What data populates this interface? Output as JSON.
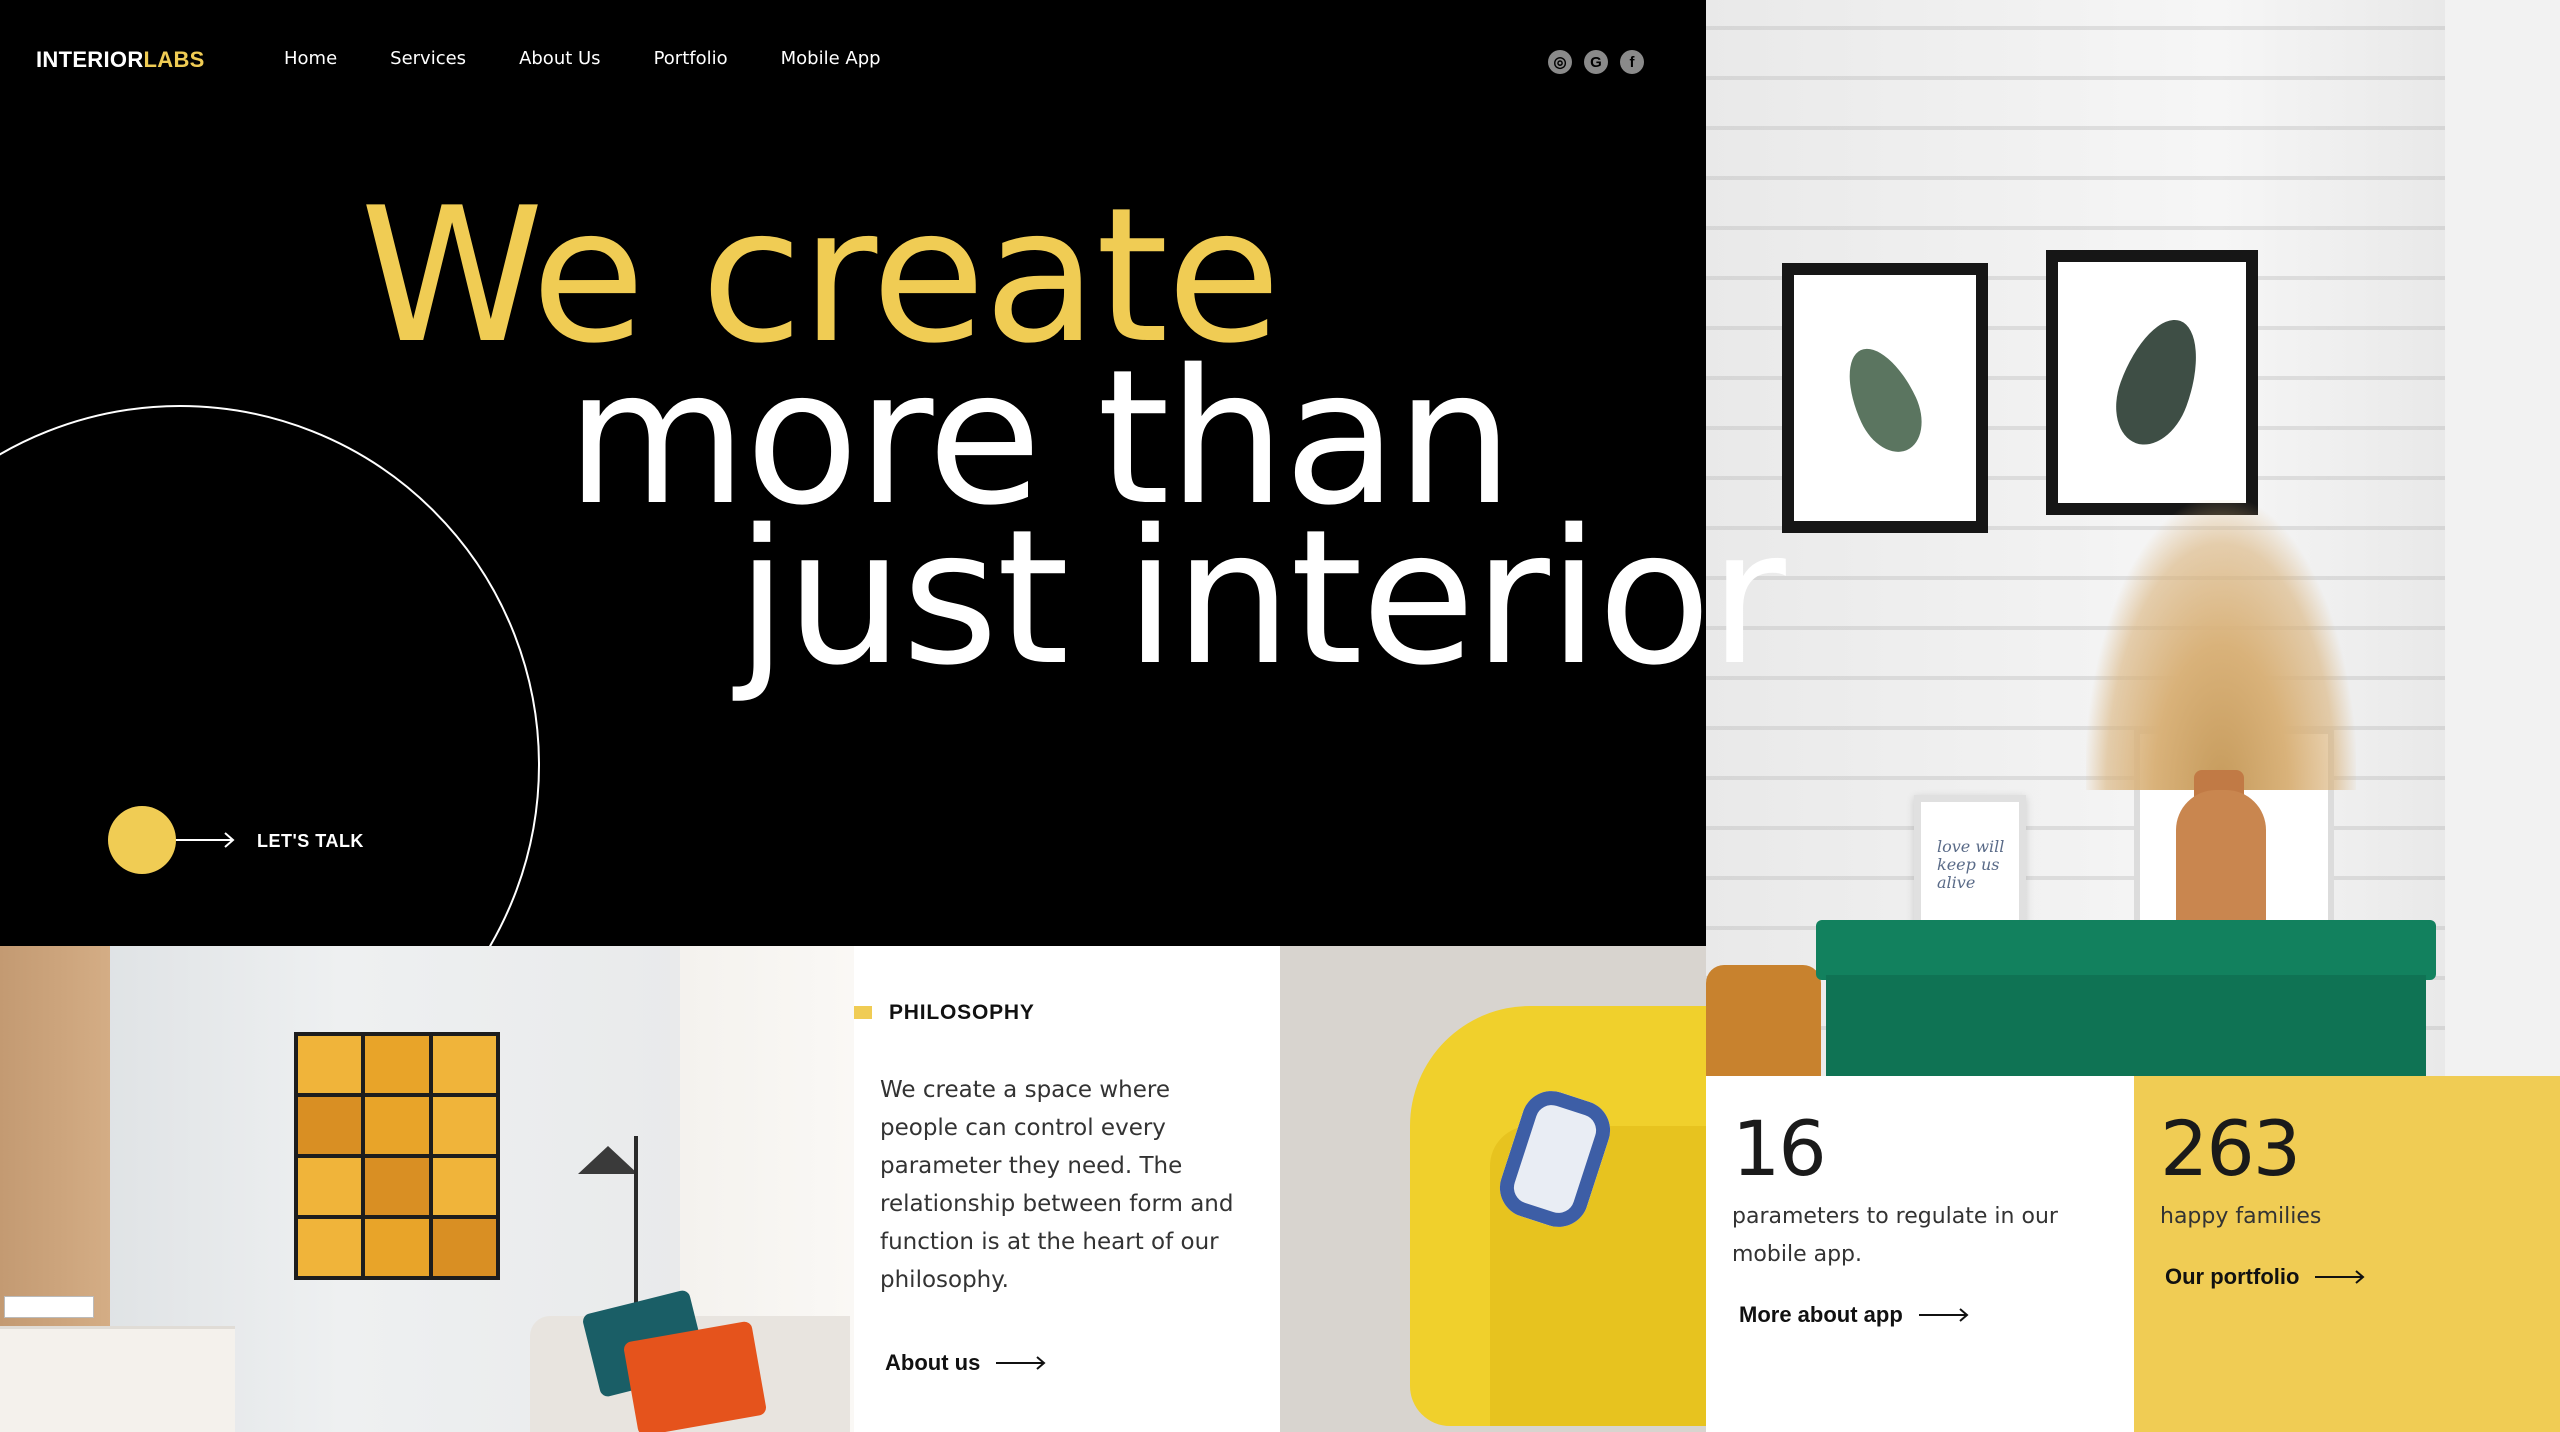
{
  "brand": {
    "part1": "INTERIOR",
    "part2": "LABS",
    "accent_color": "#f0cc54"
  },
  "nav": {
    "items": [
      {
        "label": "Home"
      },
      {
        "label": "Services"
      },
      {
        "label": "About Us"
      },
      {
        "label": "Portfolio"
      },
      {
        "label": "Mobile App"
      }
    ]
  },
  "socials": [
    {
      "icon": "instagram-icon",
      "glyph": "◎"
    },
    {
      "icon": "google-icon",
      "glyph": "G"
    },
    {
      "icon": "facebook-icon",
      "glyph": "f"
    }
  ],
  "hero": {
    "line1": "We create",
    "line2": "more than",
    "line3": "just interior",
    "cta_label": "LET'S TALK"
  },
  "philosophy": {
    "title": "PHILOSOPHY",
    "text": "We create a space where people can control every parameter they need. The relationship between form and function is at the heart of our philosophy.",
    "link_label": "About us"
  },
  "stats": [
    {
      "number": "16",
      "text": "parameters to regulate in our mobile app.",
      "link_label": "More about app"
    },
    {
      "number": "263",
      "text": "happy families",
      "link_label": "Our portfolio"
    }
  ],
  "photos": {
    "wall_frame_text": "love will keep us alive"
  }
}
